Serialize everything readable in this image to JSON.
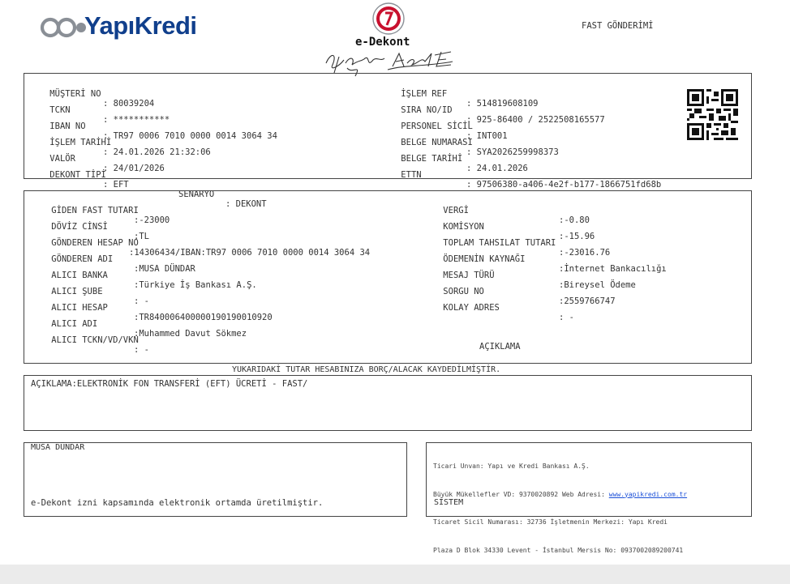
{
  "header": {
    "brand": "YapıKredi",
    "doc_type": "e-Dekont",
    "doc_kind": "FAST GÖNDERİMİ"
  },
  "info": {
    "left": [
      {
        "label": "MÜŞTERİ NO",
        "value": ": 80039204"
      },
      {
        "label": "TCKN",
        "value": ": ***********"
      },
      {
        "label": "IBAN NO",
        "value": ": TR97 0006 7010 0000 0014 3064 34"
      },
      {
        "label": "İŞLEM TARİHİ",
        "value": ": 24.01.2026 21:32:06"
      },
      {
        "label": "VALÖR",
        "value": ": 24/01/2026"
      },
      {
        "label": "DEKONT TİPİ",
        "value": ": EFT"
      }
    ],
    "scenario": {
      "label": "SENARYO",
      "value": ": DEKONT"
    },
    "right": [
      {
        "label": "İŞLEM REF",
        "value": ": 514819608109"
      },
      {
        "label": "SIRA NO/ID",
        "value": ": 925-86400 / 2522508165577"
      },
      {
        "label": "PERSONEL SİCİL",
        "value": ": INT001"
      },
      {
        "label": "BELGE NUMARASI",
        "value": ": SYA2026259998373"
      },
      {
        "label": "BELGE TARİHİ",
        "value": ": 24.01.2026"
      },
      {
        "label": "ETTN",
        "value": ": 97506380-a406-4e2f-b177-1866751fd68b"
      }
    ]
  },
  "transfer": {
    "left": [
      {
        "label": "GİDEN FAST TUTARI",
        "value": ":-23000"
      },
      {
        "label": "DÖVİZ CİNSİ",
        "value": ":TL"
      },
      {
        "label": "GÖNDEREN HESAP NO",
        "value": ":14306434/IBAN:TR97 0006 7010 0000 0014 3064 34"
      },
      {
        "label": "GÖNDEREN ADI",
        "value": ":MUSA DÜNDAR"
      },
      {
        "label": "ALICI BANKA",
        "value": ":Türkiye İş Bankası A.Ş."
      },
      {
        "label": "ALICI ŞUBE",
        "value": ": -"
      },
      {
        "label": "ALICI HESAP",
        "value": ":TR840006400000190190010920"
      },
      {
        "label": "ALICI ADI",
        "value": ":Muhammed Davut Sökmez"
      },
      {
        "label": "ALICI TCKN/VD/VKN",
        "value": ": -"
      }
    ],
    "right": [
      {
        "label": "VERGİ",
        "value": ":-0.80"
      },
      {
        "label": "KOMİSYON",
        "value": ":-15.96"
      },
      {
        "label": "TOPLAM TAHSILAT TUTARI",
        "value": ":-23016.76"
      },
      {
        "label": "ÖDEMENİN KAYNAĞI",
        "value": ":İnternet Bankacılığı"
      },
      {
        "label": "MESAJ TÜRÜ",
        "value": ":Bireysel Ödeme"
      },
      {
        "label": "SORGU NO",
        "value": ":2559766747"
      },
      {
        "label": "KOLAY ADRES",
        "value": ": -"
      }
    ],
    "aciklama_heading": "AÇIKLAMA"
  },
  "notice": "YUKARIDAKİ TUTAR HESABINIZA BORÇ/ALACAK KAYDEDİLMİŞTİR.",
  "description": "AÇIKLAMA:ELEKTRONİK FON TRANSFERİ (EFT) ÜCRETİ - FAST/",
  "bottom_left": {
    "name": "MUSA DÜNDAR",
    "note": "e-Dekont izni kapsamında elektronik ortamda üretilmiştir."
  },
  "bottom_right": {
    "line1": "Ticari Unvan: Yapı ve Kredi Bankası A.Ş.",
    "line2_prefix": "Büyük Mükellefler VD: 9370020892 Web Adresi: ",
    "website": "www.yapikredi.com.tr",
    "line3": "Ticaret Sicil Numarası: 32736 İşletmenin Merkezi: Yapı Kredi",
    "line4": "Plaza D Blok 34330 Levent - İstanbul Mersis No: 0937002089200741",
    "system": "SİSTEM"
  },
  "colors": {
    "brand_blue": "#103f8c",
    "seal_red": "#c8102e",
    "border": "#444444",
    "link": "#1a4fd8"
  }
}
